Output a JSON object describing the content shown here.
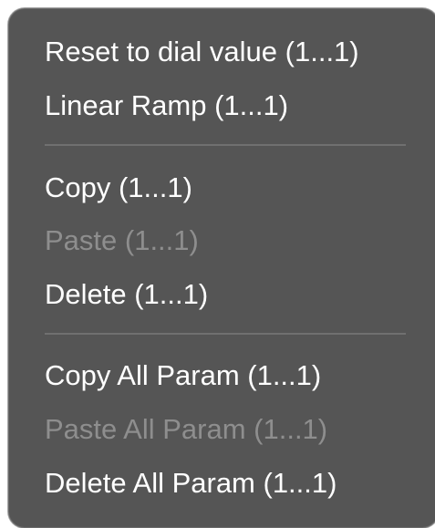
{
  "menu": {
    "groups": [
      {
        "items": [
          {
            "label": "Reset to dial value (1...1)",
            "enabled": true
          },
          {
            "label": "Linear Ramp (1...1)",
            "enabled": true
          }
        ]
      },
      {
        "items": [
          {
            "label": "Copy (1...1)",
            "enabled": true
          },
          {
            "label": "Paste (1...1)",
            "enabled": false
          },
          {
            "label": "Delete (1...1)",
            "enabled": true
          }
        ]
      },
      {
        "items": [
          {
            "label": "Copy All Param (1...1)",
            "enabled": true
          },
          {
            "label": "Paste All Param (1...1)",
            "enabled": false
          },
          {
            "label": "Delete All Param (1...1)",
            "enabled": true
          }
        ]
      }
    ]
  },
  "colors": {
    "menu_background": "#555555",
    "text_enabled": "#ffffff",
    "text_disabled": "#8e8e8e",
    "separator": "#707070"
  }
}
